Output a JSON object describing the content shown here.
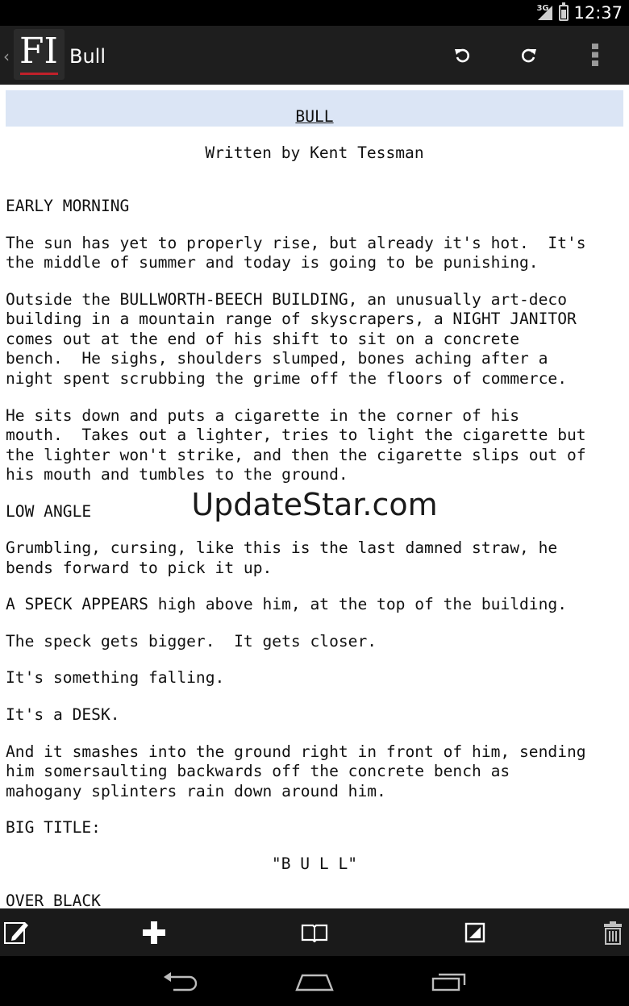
{
  "status_bar": {
    "network": "3G",
    "time": "12:37",
    "battery_level": 0.75,
    "icons": [
      "signal-icon",
      "battery-icon"
    ]
  },
  "action_bar": {
    "app_logo_text": "FI",
    "title": "Bull",
    "actions": [
      "undo-icon",
      "redo-icon",
      "overflow-menu-icon"
    ]
  },
  "document": {
    "title": "BULL",
    "byline": "Written by Kent Tessman",
    "lines": [
      "EARLY MORNING",
      "The sun has yet to properly rise, but already it's hot.  It's",
      "the middle of summer and today is going to be punishing.",
      "Outside the BULLWORTH-BEECH BUILDING, an unusually art-deco",
      "building in a mountain range of skyscrapers, a NIGHT JANITOR",
      "comes out at the end of his shift to sit on a concrete",
      "bench.  He sighs, shoulders slumped, bones aching after a",
      "night spent scrubbing the grime off the floors of commerce.",
      "He sits down and puts a cigarette in the corner of his",
      "mouth.  Takes out a lighter, tries to light the cigarette but",
      "the lighter won't strike, and then the cigarette slips out of",
      "his mouth and tumbles to the ground.",
      "LOW ANGLE",
      "Grumbling, cursing, like this is the last damned straw, he",
      "bends forward to pick it up.",
      "A SPECK APPEARS high above him, at the top of the building.",
      "The speck gets bigger.  It gets closer.",
      "It's something falling.",
      "It's a DESK.",
      "And it smashes into the ground right in front of him, sending",
      "him somersaulting backwards off the concrete bench as",
      "mahogany splinters rain down around him.",
      "BIG TITLE:",
      "OVER BLACK"
    ],
    "centered_title": "\"B U L L\"",
    "watermark": "UpdateStar.com"
  },
  "bottom_toolbar": [
    "edit-icon",
    "add-icon",
    "book-icon",
    "page-icon",
    "trash-icon"
  ],
  "nav_bar": [
    "back-icon",
    "home-icon",
    "recents-icon"
  ]
}
